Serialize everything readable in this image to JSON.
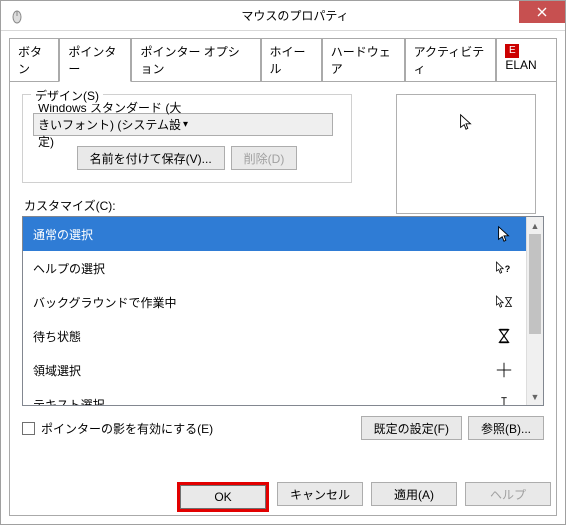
{
  "window": {
    "title": "マウスのプロパティ"
  },
  "tabs": {
    "items": [
      {
        "label": "ボタン"
      },
      {
        "label": "ポインター"
      },
      {
        "label": "ポインター オプション"
      },
      {
        "label": "ホイール"
      },
      {
        "label": "ハードウェア"
      },
      {
        "label": "アクティビティ"
      },
      {
        "label": "ELAN"
      }
    ]
  },
  "design": {
    "group_title": "デザイン(S)",
    "scheme": "Windows スタンダード (大きいフォント) (システム設定)",
    "save_as": "名前を付けて保存(V)...",
    "delete": "削除(D)"
  },
  "customize": {
    "label": "カスタマイズ(C):",
    "items": [
      {
        "label": "通常の選択",
        "icon": "arrow"
      },
      {
        "label": "ヘルプの選択",
        "icon": "arrow-help"
      },
      {
        "label": "バックグラウンドで作業中",
        "icon": "arrow-wait"
      },
      {
        "label": "待ち状態",
        "icon": "hourglass"
      },
      {
        "label": "領域選択",
        "icon": "cross"
      },
      {
        "label": "テキスト選択",
        "icon": "ibeam"
      }
    ]
  },
  "shadow_checkbox": "ポインターの影を有効にする(E)",
  "defaults_btn": "既定の設定(F)",
  "browse_btn": "参照(B)...",
  "buttons": {
    "ok": "OK",
    "cancel": "キャンセル",
    "apply": "適用(A)",
    "help": "ヘルプ"
  }
}
